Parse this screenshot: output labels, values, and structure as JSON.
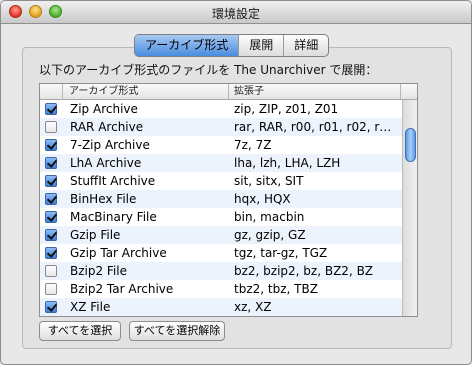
{
  "window": {
    "title": "環境設定"
  },
  "tabs": [
    {
      "label": "アーカイブ形式",
      "active": true
    },
    {
      "label": "展開",
      "active": false
    },
    {
      "label": "詳細",
      "active": false
    }
  ],
  "description": "以下のアーカイブ形式のファイルを The Unarchiver で展開：",
  "table": {
    "headers": {
      "format": "アーカイブ形式",
      "extension": "拡張子"
    },
    "rows": [
      {
        "checked": true,
        "name": "Zip Archive",
        "ext": "zip, ZIP, z01, Z01"
      },
      {
        "checked": false,
        "name": "RAR Archive",
        "ext": "rar, RAR, r00, r01, r02, r…"
      },
      {
        "checked": true,
        "name": "7-Zip Archive",
        "ext": "7z, 7Z"
      },
      {
        "checked": true,
        "name": "LhA Archive",
        "ext": "lha, lzh, LHA, LZH"
      },
      {
        "checked": true,
        "name": "StuffIt Archive",
        "ext": "sit, sitx, SIT"
      },
      {
        "checked": true,
        "name": "BinHex File",
        "ext": "hqx, HQX"
      },
      {
        "checked": true,
        "name": "MacBinary File",
        "ext": "bin, macbin"
      },
      {
        "checked": true,
        "name": "Gzip File",
        "ext": "gz, gzip, GZ"
      },
      {
        "checked": true,
        "name": "Gzip Tar Archive",
        "ext": "tgz, tar-gz, TGZ"
      },
      {
        "checked": false,
        "name": "Bzip2 File",
        "ext": "bz2, bzip2, bz, BZ2, BZ"
      },
      {
        "checked": false,
        "name": "Bzip2 Tar Archive",
        "ext": "tbz2, tbz, TBZ"
      },
      {
        "checked": true,
        "name": "XZ File",
        "ext": "xz, XZ"
      }
    ]
  },
  "buttons": {
    "select_all": "すべてを選択",
    "deselect_all": "すべてを選択解除"
  },
  "colors": {
    "accent": "#4a8de0",
    "row_alt": "#edf3fd"
  }
}
